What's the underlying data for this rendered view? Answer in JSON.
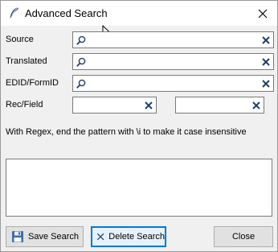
{
  "window": {
    "title": "Advanced Search",
    "close_glyph": "✕"
  },
  "fields": {
    "source_label": "Source",
    "translated_label": "Translated",
    "edid_label": "EDID/FormID",
    "recfield_label": "Rec/Field",
    "source_value": "",
    "translated_value": "",
    "edid_value": "",
    "rec_value": "",
    "field_value": ""
  },
  "hint": "With Regex, end the pattern with \\i to make it case insensitive",
  "results_text": "",
  "buttons": {
    "save": "Save Search",
    "delete": "Delete Search",
    "close": "Close"
  },
  "icons": {
    "title": "quill-icon",
    "search": "magnifier-icon",
    "clear": "clear-x-icon",
    "save": "save-icon",
    "delete": "delete-x-icon"
  },
  "colors": {
    "clear_icon": "#1f3f6b",
    "focus_border": "#0078d7"
  }
}
